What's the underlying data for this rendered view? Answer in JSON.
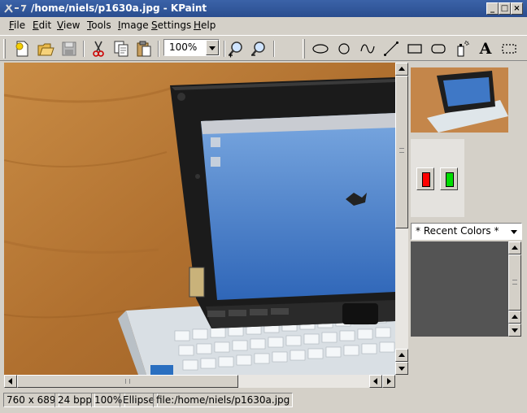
{
  "window": {
    "title": "/home/niels/p1630a.jpg - KPaint",
    "buttons": [
      "_",
      "□",
      "×"
    ]
  },
  "menu": {
    "items": [
      {
        "label": "File",
        "underline": "F"
      },
      {
        "label": "Edit",
        "underline": "E"
      },
      {
        "label": "View",
        "underline": "V"
      },
      {
        "label": "Tools",
        "underline": "T"
      },
      {
        "label": "Image",
        "underline": "I"
      },
      {
        "label": "Settings",
        "underline": "S"
      },
      {
        "label": "Help",
        "underline": "H"
      }
    ]
  },
  "toolbar": {
    "file_tools": [
      "new-icon",
      "open-icon",
      "save-icon"
    ],
    "edit_tools": [
      "cut-icon",
      "copy-icon",
      "paste-icon"
    ],
    "zoom": {
      "value": "100%"
    },
    "zoom_tools": [
      "zoom-in-icon",
      "zoom-out-icon"
    ],
    "draw_tools": [
      "ellipse-icon",
      "circle-icon",
      "pen-icon",
      "line-icon",
      "rectangle-icon",
      "rounded-rectangle-icon",
      "spraycan-icon",
      "text-icon",
      "select-area-icon"
    ],
    "text_tool_label": "A"
  },
  "colors": {
    "foreground": "#ff0000",
    "background": "#00dd00"
  },
  "recent_colors": {
    "label": "* Recent Colors *"
  },
  "status": {
    "size": "760 x 689",
    "depth": "24 bpp",
    "zoom": "100%",
    "tool": "Ellipse",
    "file": "file:/home/niels/p1630a.jpg"
  }
}
